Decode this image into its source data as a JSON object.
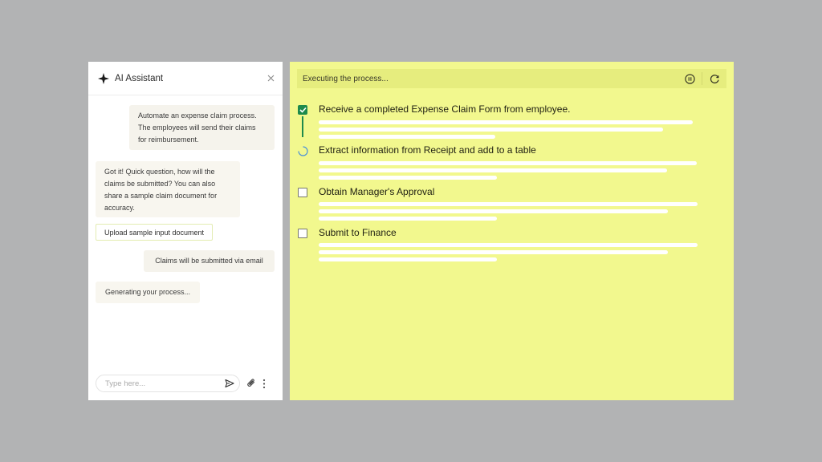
{
  "chat": {
    "title": "AI Assistant",
    "messages": [
      {
        "role": "user",
        "text": "Automate an expense claim process. The employees will send their claims for reimbursement."
      },
      {
        "role": "assistant",
        "text": "Got it! Quick question, how will the claims be submitted? You can also share a sample claim document for accuracy."
      },
      {
        "role": "user",
        "text": "Claims will be submitted via email"
      },
      {
        "role": "assistant",
        "text": "Generating your process..."
      }
    ],
    "upload_label": "Upload sample input document",
    "input_placeholder": "Type here..."
  },
  "process": {
    "status": "Executing the process...",
    "steps": [
      {
        "label": "Receive a completed Expense Claim Form from employee.",
        "state": "done"
      },
      {
        "label": "Extract information from Receipt and add to a table",
        "state": "in-progress"
      },
      {
        "label": "Obtain Manager's Approval",
        "state": "pending"
      },
      {
        "label": "Submit to Finance",
        "state": "pending"
      }
    ]
  },
  "colors": {
    "background": "#b2b3b4",
    "process_panel": "#f2f88e",
    "status_bar": "#e6ed7e",
    "check_green": "#1e8a4c",
    "spinner_blue": "#4a90d9"
  },
  "icons": {
    "header": "sparkle-icon",
    "close": "close-icon",
    "send": "send-icon",
    "attach": "paperclip-icon",
    "more": "more-vertical-icon",
    "pause": "pause-icon",
    "reload": "reload-icon"
  }
}
